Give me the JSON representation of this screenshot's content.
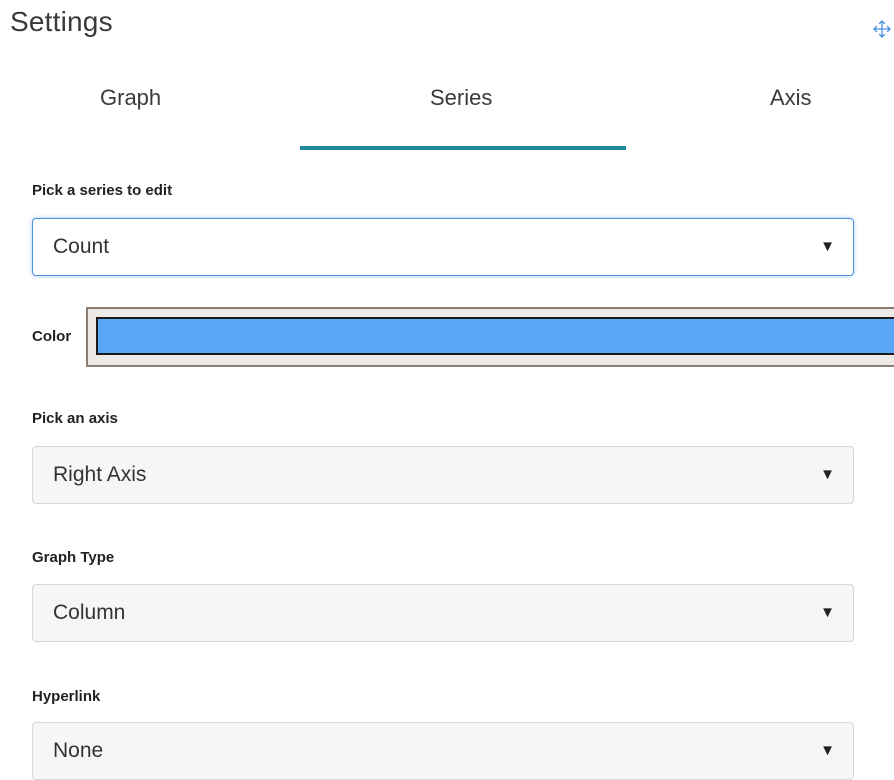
{
  "header": {
    "title": "Settings",
    "move_icon": "move-arrows-icon"
  },
  "tabs": [
    {
      "label": "Graph",
      "active": false
    },
    {
      "label": "Series",
      "active": true
    },
    {
      "label": "Axis",
      "active": false
    }
  ],
  "accent_color": "#1e8a9c",
  "series_picker": {
    "label": "Pick a series to edit",
    "value": "Count"
  },
  "color_picker": {
    "label": "Color",
    "value": "#5aa5f5"
  },
  "axis_picker": {
    "label": "Pick an axis",
    "value": "Right Axis"
  },
  "graph_type_picker": {
    "label": "Graph Type",
    "value": "Column"
  },
  "hyperlink_picker": {
    "label": "Hyperlink",
    "value": "None"
  },
  "caret_glyph": "▼"
}
